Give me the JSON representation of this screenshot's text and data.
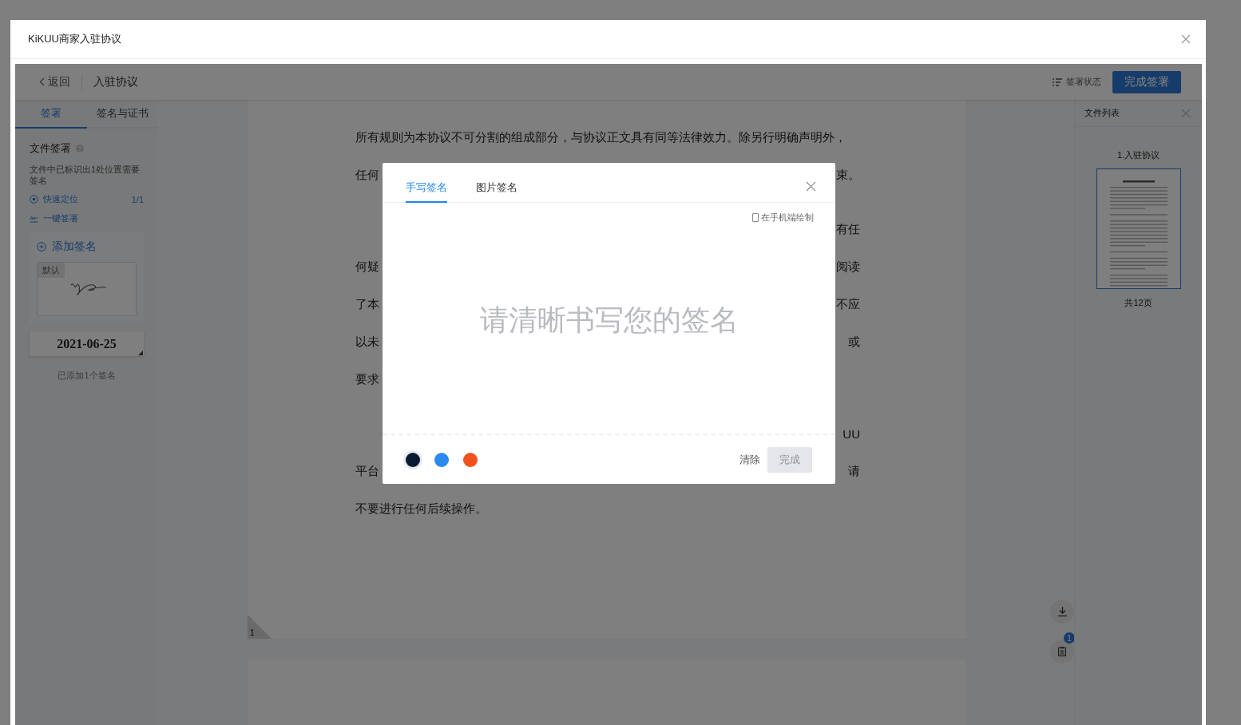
{
  "dialog": {
    "title": "KiKUU商家入驻协议"
  },
  "toolbar": {
    "back": "返回",
    "document_title": "入驻协议",
    "status_button": "签署状态",
    "finish_button": "完成签署"
  },
  "sidebar": {
    "tabs": [
      {
        "label": "签署",
        "selected": true
      },
      {
        "label": "签名与证书",
        "selected": false
      }
    ],
    "section_title": "文件签署",
    "notice": "文件中已标识出1处位置需要签名",
    "actions": [
      {
        "kind": "locate",
        "label": "快速定位",
        "count": "1/1"
      },
      {
        "kind": "batch",
        "label": "一键签署"
      }
    ],
    "add_signature": "添加签名",
    "signatures": [
      {
        "tag": "默认"
      }
    ],
    "date_stamp": "2021-06-25",
    "summary": "已添加1个签名"
  },
  "document": {
    "paragraphs": [
      {
        "lines": [
          {
            "left": "所有规则为本协议不可分割的组成部分，与协议正文具有同等法律效力。除另行明确声明外，"
          },
          {
            "left": "任何",
            "right": "束。"
          }
        ]
      },
      {
        "lines": [
          {
            "right": "有任"
          },
          {
            "left": "何疑",
            "right": "阅读"
          },
          {
            "left": "了本",
            "right": "不应"
          },
          {
            "left": "以未",
            "right": "或"
          },
          {
            "left": "要求"
          }
        ]
      },
      {
        "lines": [
          {
            "right": "UU"
          },
          {
            "left": "平台",
            "right": "请"
          },
          {
            "left": "不要进行任何后续操作。"
          }
        ]
      }
    ],
    "page_number": "1",
    "notes_badge": "1"
  },
  "file_panel": {
    "title": "文件列表",
    "files": [
      {
        "name": "1.入驻协议",
        "selected": true
      }
    ],
    "page_count": "共12页"
  },
  "signature_dialog": {
    "tabs": [
      {
        "label": "手写签名",
        "selected": true
      },
      {
        "label": "图片签名",
        "selected": false
      }
    ],
    "mobile_option": {
      "label": "在手机端绘制",
      "checked": false
    },
    "placeholder": "请清晰书写您的签名",
    "pen_colors": [
      {
        "color": "#0b1a33",
        "selected": true
      },
      {
        "color": "#2b8af0",
        "selected": false
      },
      {
        "color": "#f0521e",
        "selected": false
      }
    ],
    "clear": "清除",
    "done": {
      "label": "完成",
      "disabled": true
    }
  }
}
